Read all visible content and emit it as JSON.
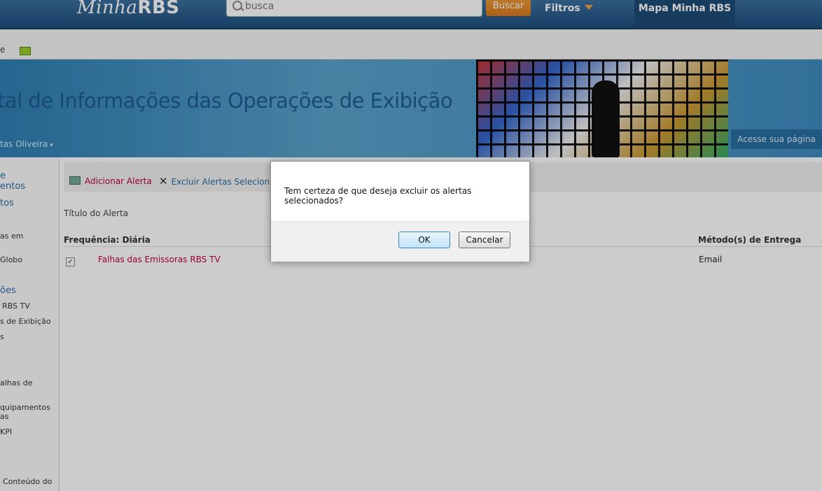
{
  "header": {
    "logo_script": "Minha",
    "logo_bold": "RBS",
    "search_placeholder": "busca",
    "search_button": "Buscar",
    "filters": "Filtros",
    "map_link": "Mapa Minha RBS"
  },
  "ribbon": {
    "fragment": "e"
  },
  "banner": {
    "title": "tal de Informações das Operações de Exibição",
    "user": "tas Oliveira",
    "visit_page": "Acesse sua página"
  },
  "leftnav": {
    "items": [
      {
        "text": "e",
        "kind": "hd"
      },
      {
        "text": "entos",
        "kind": "hd"
      },
      {
        "text": "tos",
        "kind": "hd"
      },
      {
        "text": "as em",
        "kind": "item"
      },
      {
        "text": "Globo",
        "kind": "item"
      },
      {
        "text": "ões",
        "kind": "hd"
      },
      {
        "text": "RBS TV",
        "kind": "item"
      },
      {
        "text": "s de Exibição",
        "kind": "item"
      },
      {
        "text": "s",
        "kind": "item"
      },
      {
        "text": "alhas de",
        "kind": "item"
      },
      {
        "text": "quipamentos",
        "kind": "item"
      },
      {
        "text": "as",
        "kind": "item"
      },
      {
        "text": "KPI",
        "kind": "item"
      },
      {
        "text": "Conteúdo do",
        "kind": "item"
      }
    ]
  },
  "toolbar": {
    "add_alert": "Adicionar Alerta",
    "delete_alerts": "Excluir Alertas Selecionad"
  },
  "list": {
    "title_header": "Título do Alerta",
    "frequency_header": "Frequência: Diária",
    "delivery_header": "Método(s) de Entrega",
    "rows": [
      {
        "title": "Falhas das Emissoras RBS TV",
        "delivery": "Email",
        "checked": true
      }
    ]
  },
  "dialog": {
    "message": "Tem certeza de que deseja excluir os alertas selecionados?",
    "ok": "OK",
    "cancel": "Cancelar"
  },
  "colors": {
    "header_blue": "#1f4f7d",
    "accent_orange": "#e08a2a",
    "link_red": "#c0003a",
    "link_blue": "#2a6ea3"
  }
}
